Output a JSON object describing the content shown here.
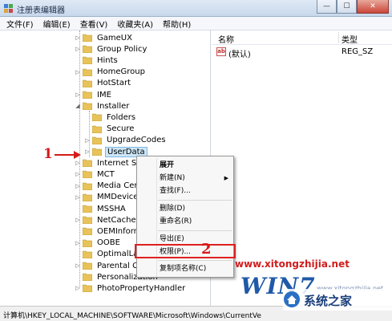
{
  "window": {
    "title": "注册表编辑器",
    "minimize_glyph": "—",
    "maximize_glyph": "☐",
    "close_glyph": "✕"
  },
  "menubar": [
    "文件(F)",
    "编辑(E)",
    "查看(V)",
    "收藏夹(A)",
    "帮助(H)"
  ],
  "tree": [
    {
      "label": "GameUX",
      "expander": "▷"
    },
    {
      "label": "Group Policy",
      "expander": "▷"
    },
    {
      "label": "Hints",
      "expander": ""
    },
    {
      "label": "HomeGroup",
      "expander": "▷"
    },
    {
      "label": "HotStart",
      "expander": ""
    },
    {
      "label": "IME",
      "expander": "▷"
    },
    {
      "label": "Installer",
      "expander": "◢"
    },
    {
      "label": "Folders",
      "expander": ""
    },
    {
      "label": "Secure",
      "expander": ""
    },
    {
      "label": "UpgradeCodes",
      "expander": "▷"
    },
    {
      "label": "UserData",
      "expander": "▷"
    },
    {
      "label": "Internet Setti",
      "expander": "▷"
    },
    {
      "label": "MCT",
      "expander": "▷"
    },
    {
      "label": "Media Cente",
      "expander": "▷"
    },
    {
      "label": "MMDevices",
      "expander": "▷"
    },
    {
      "label": "MSSHA",
      "expander": ""
    },
    {
      "label": "NetCache",
      "expander": "▷"
    },
    {
      "label": "OEMInforma",
      "expander": ""
    },
    {
      "label": "OOBE",
      "expander": "▷"
    },
    {
      "label": "OptimalLayo",
      "expander": ""
    },
    {
      "label": "Parental Con",
      "expander": "▷"
    },
    {
      "label": "Personalization",
      "expander": ""
    },
    {
      "label": "PhotoPropertyHandler",
      "expander": "▷"
    }
  ],
  "list": {
    "col_name": "名称",
    "col_type": "类型",
    "rows": [
      {
        "icon": "ab",
        "name": "(默认)",
        "type": "REG_SZ"
      }
    ]
  },
  "context_menu": {
    "expand": "展开",
    "new": "新建(N)",
    "new_arrow": "▶",
    "find": "查找(F)...",
    "delete": "删除(D)",
    "rename": "重命名(R)",
    "export": "导出(E)",
    "permissions": "权限(P)...",
    "copy_key_name": "复制项名称(C)"
  },
  "annotations": {
    "step1": "1",
    "step2": "2"
  },
  "status": {
    "path": "计算机\\HKEY_LOCAL_MACHINE\\SOFTWARE\\Microsoft\\Windows\\CurrentVe"
  },
  "watermark": {
    "text": "www.xitongzhijia.net",
    "logo": "WIN7",
    "site": "www.xitongzhijia.net",
    "badge": "系统之家"
  },
  "colors": {
    "annotation_red": "#d51a1a",
    "folder_yellow": "#e8c35a",
    "selection_blue": "#cde6f7"
  },
  "icons": {
    "app": "registry-editor-icon",
    "folder": "folder-icon",
    "string_value": "reg-sz-icon",
    "badge": "house-logo-icon"
  }
}
